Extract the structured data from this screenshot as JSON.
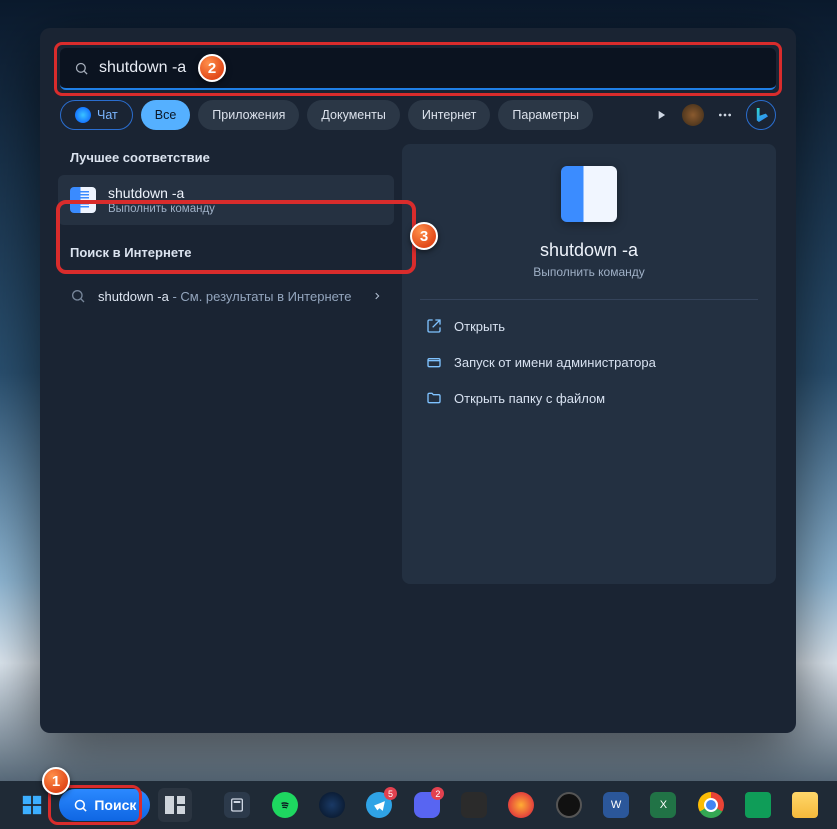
{
  "search": {
    "value": "shutdown -a"
  },
  "filters": {
    "chat": "Чат",
    "all": "Все",
    "apps": "Приложения",
    "docs": "Документы",
    "web": "Интернет",
    "settings": "Параметры"
  },
  "left": {
    "best_match": "Лучшее соответствие",
    "result": {
      "title": "shutdown -a",
      "subtitle": "Выполнить команду"
    },
    "search_web": "Поиск в Интернете",
    "web_result_prefix": "shutdown -a",
    "web_result_suffix": " - См. результаты в Интернете"
  },
  "right": {
    "title": "shutdown -a",
    "subtitle": "Выполнить команду",
    "actions": {
      "open": "Открыть",
      "admin": "Запуск от имени администратора",
      "folder": "Открыть папку с файлом"
    }
  },
  "taskbar": {
    "search_label": "Поиск",
    "badges": {
      "tg": "5",
      "disc": "2"
    }
  },
  "steps": {
    "s1": "1",
    "s2": "2",
    "s3": "3"
  }
}
